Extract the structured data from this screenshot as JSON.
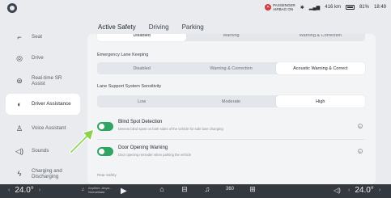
{
  "status": {
    "airbag_line1": "PASSENGER",
    "airbag_line2": "AIRBAG ON",
    "range": "416 km",
    "battery": "81%",
    "time": "18:49"
  },
  "sidebar": {
    "items": [
      {
        "label": "Seat",
        "icon": "seat-icon"
      },
      {
        "label": "Drive",
        "icon": "steering-icon"
      },
      {
        "label": "Real-time SR Assist",
        "icon": "car-icon"
      },
      {
        "label": "Driver Assistance",
        "icon": "assist-icon"
      },
      {
        "label": "Voice Assistant",
        "icon": "voice-icon"
      },
      {
        "label": "Sounds",
        "icon": "speaker-icon"
      },
      {
        "label": "Charging and Discharging",
        "icon": "charging-icon"
      }
    ],
    "active_index": 3
  },
  "tabs": [
    "Active Safety",
    "Driving",
    "Parking"
  ],
  "active_tab": "Active Safety",
  "top_segment": {
    "options": [
      "Disabled",
      "Warning",
      "Warning & Correction"
    ]
  },
  "lane_keeping": {
    "title": "Emergency Lane Keeping",
    "options": [
      "Disabled",
      "Warning & Correction",
      "Acoustic Warning & Correct"
    ],
    "selected": "Acoustic Warning & Correct"
  },
  "sensitivity": {
    "title": "Lane Support System Sensitivity",
    "options": [
      "Low",
      "Moderate",
      "High"
    ],
    "selected": "High"
  },
  "blind_spot": {
    "title": "Blind Spot Detection",
    "desc": "Detects blind spots on both sides of the vehicle for safe lane changing",
    "enabled": true
  },
  "door_warning": {
    "title": "Door Opening Warning",
    "desc": "Door opening reminder when parking the vehicle",
    "enabled": true
  },
  "rear_safety": {
    "title": "Rear Safety"
  },
  "bottom": {
    "left_temp": "24.0°",
    "right_temp": "24.0°",
    "media_line1": "Anytime, Anyw...",
    "media_line2": "Nomarikala",
    "fan_level": "360"
  },
  "colors": {
    "toggle_on": "#2fa463",
    "arrow": "#8fd14f",
    "bottom_bar": "#34383f"
  }
}
